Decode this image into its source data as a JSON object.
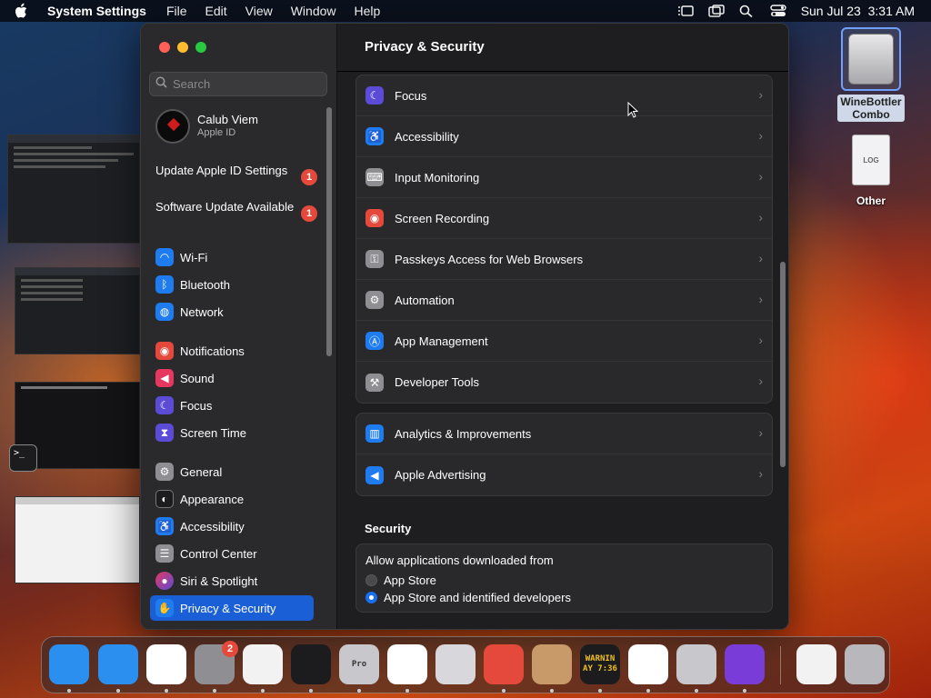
{
  "menubar": {
    "app_name": "System Settings",
    "menus": [
      "File",
      "Edit",
      "View",
      "Window",
      "Help"
    ],
    "clock": "Sun Jul 23  3:31 AM"
  },
  "window": {
    "search": {
      "placeholder": "Search"
    },
    "user": {
      "name": "Calub Viem",
      "subtitle": "Apple ID"
    },
    "notices": [
      {
        "label": "Update Apple ID Settings",
        "badge": "1"
      },
      {
        "label": "Software Update Available",
        "badge": "1"
      }
    ],
    "sidebar_items": [
      {
        "label": "Wi-Fi",
        "icon": "wifi-icon",
        "color": "#1e7cf0"
      },
      {
        "label": "Bluetooth",
        "icon": "bluetooth-icon",
        "color": "#1e7cf0"
      },
      {
        "label": "Network",
        "icon": "globe-icon",
        "color": "#1e7cf0"
      },
      {
        "label": "Notifications",
        "icon": "bell-icon",
        "color": "#e5493c"
      },
      {
        "label": "Sound",
        "icon": "speaker-icon",
        "color": "#e5375f"
      },
      {
        "label": "Focus",
        "icon": "moon-icon",
        "color": "#5b4bd6"
      },
      {
        "label": "Screen Time",
        "icon": "hourglass-icon",
        "color": "#5b4bd6"
      },
      {
        "label": "General",
        "icon": "gear-icon",
        "color": "#8e8e93"
      },
      {
        "label": "Appearance",
        "icon": "appearance-icon",
        "color": "#1c1c1e"
      },
      {
        "label": "Accessibility",
        "icon": "accessibility-icon",
        "color": "#1e7cf0"
      },
      {
        "label": "Control Center",
        "icon": "control-center-icon",
        "color": "#8e8e93"
      },
      {
        "label": "Siri & Spotlight",
        "icon": "siri-icon",
        "color": "#b03cd8"
      },
      {
        "label": "Privacy & Security",
        "icon": "hand-icon",
        "color": "#1e7cf0"
      }
    ],
    "main": {
      "title": "Privacy & Security",
      "rows_group1": [
        {
          "label": "Focus",
          "icon": "moon-icon",
          "color": "#5b4bd6"
        },
        {
          "label": "Accessibility",
          "icon": "accessibility-icon",
          "color": "#1e7cf0"
        },
        {
          "label": "Input Monitoring",
          "icon": "keyboard-icon",
          "color": "#8e8e93"
        },
        {
          "label": "Screen Recording",
          "icon": "record-icon",
          "color": "#e5493c"
        },
        {
          "label": "Passkeys Access for Web Browsers",
          "icon": "passkey-icon",
          "color": "#8e8e93"
        },
        {
          "label": "Automation",
          "icon": "gear-icon",
          "color": "#8e8e93"
        },
        {
          "label": "App Management",
          "icon": "appstore-icon",
          "color": "#1e7cf0"
        },
        {
          "label": "Developer Tools",
          "icon": "hammer-icon",
          "color": "#8e8e93"
        }
      ],
      "rows_group2": [
        {
          "label": "Analytics & Improvements",
          "icon": "chart-icon",
          "color": "#1e7cf0"
        },
        {
          "label": "Apple Advertising",
          "icon": "megaphone-icon",
          "color": "#1e7cf0"
        }
      ],
      "security_header": "Security",
      "security_question": "Allow applications downloaded from",
      "security_options": [
        {
          "label": "App Store",
          "selected": false
        },
        {
          "label": "App Store and identified developers",
          "selected": true
        }
      ]
    }
  },
  "desktop_icons": [
    {
      "label_line1": "WineBottler",
      "label_line2": "Combo",
      "icon": "disk-icon"
    },
    {
      "label_line1": "Other",
      "label_line2": "",
      "icon": "document-icon"
    }
  ],
  "dock": {
    "apps": [
      {
        "name": "finder-icon",
        "color": "#2b8ff0"
      },
      {
        "name": "safari-icon",
        "color": "#2b8ff0"
      },
      {
        "name": "chrome-icon",
        "color": "#ffffff"
      },
      {
        "name": "system-settings-icon",
        "color": "#8e8e93",
        "badge": "2"
      },
      {
        "name": "textedit-icon",
        "color": "#f2f2f2"
      },
      {
        "name": "terminal-icon",
        "color": "#1c1c1e"
      },
      {
        "name": "pro-app-icon",
        "color": "#c8c8cc",
        "text": "Pro"
      },
      {
        "name": "vscode-icon",
        "color": "#ffffff"
      },
      {
        "name": "launchpad-icon",
        "color": "#d8d8dc"
      },
      {
        "name": "remote-desktop-icon",
        "color": "#e5493c"
      },
      {
        "name": "archive-icon",
        "color": "#c89a6a"
      },
      {
        "name": "console-icon",
        "color": "#1c1c1e",
        "text": "WARNIN AY 7:36"
      },
      {
        "name": "parallels-icon",
        "color": "#ffffff"
      },
      {
        "name": "automator-icon",
        "color": "#c8c8cc"
      },
      {
        "name": "firefox-icon",
        "color": "#7a3cd8"
      },
      {
        "name": "downloads-icon",
        "color": "#f2f2f2"
      },
      {
        "name": "trash-icon",
        "color": "#b8b8bc"
      }
    ]
  }
}
